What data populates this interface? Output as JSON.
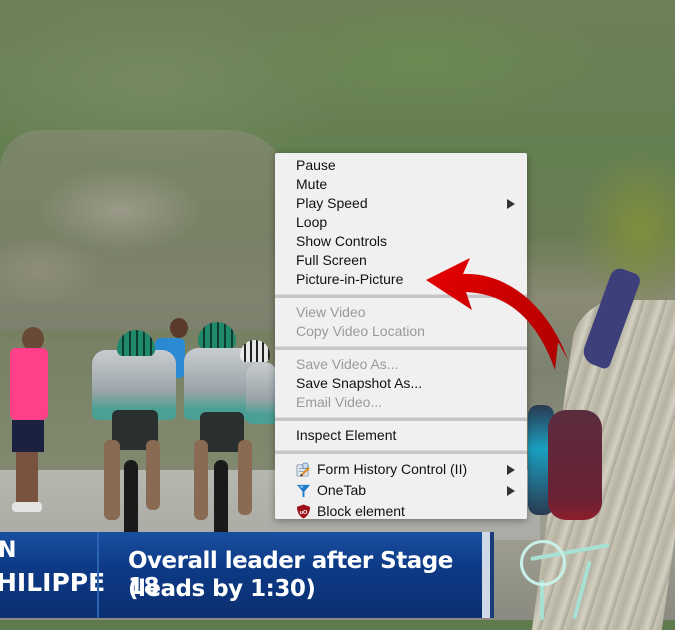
{
  "video": {
    "overlay": {
      "name_line1": "N",
      "name_line2": "HILIPPE",
      "caption_line1": "Overall leader after Stage 18",
      "caption_line2": "(leads by 1:30)"
    }
  },
  "context_menu": {
    "groups": [
      [
        {
          "label": "Pause",
          "enabled": true
        },
        {
          "label": "Mute",
          "enabled": true
        },
        {
          "label": "Play Speed",
          "enabled": true,
          "submenu": true
        },
        {
          "label": "Loop",
          "enabled": true
        },
        {
          "label": "Show Controls",
          "enabled": true
        },
        {
          "label": "Full Screen",
          "enabled": true
        },
        {
          "label": "Picture-in-Picture",
          "enabled": true
        }
      ],
      [
        {
          "label": "View Video",
          "enabled": false
        },
        {
          "label": "Copy Video Location",
          "enabled": false
        }
      ],
      [
        {
          "label": "Save Video As...",
          "enabled": false
        },
        {
          "label": "Save Snapshot As...",
          "enabled": true
        },
        {
          "label": "Email Video...",
          "enabled": false
        }
      ],
      [
        {
          "label": "Inspect Element",
          "enabled": true
        }
      ],
      [
        {
          "label": "Form History Control (II)",
          "enabled": true,
          "submenu": true,
          "icon": "form-history-icon"
        },
        {
          "label": "OneTab",
          "enabled": true,
          "submenu": true,
          "icon": "onetab-icon"
        },
        {
          "label": "Block element",
          "enabled": true,
          "icon": "ublock-icon"
        }
      ]
    ]
  },
  "annotation": {
    "arrow_color": "#d40000",
    "points_to": "Picture-in-Picture"
  }
}
